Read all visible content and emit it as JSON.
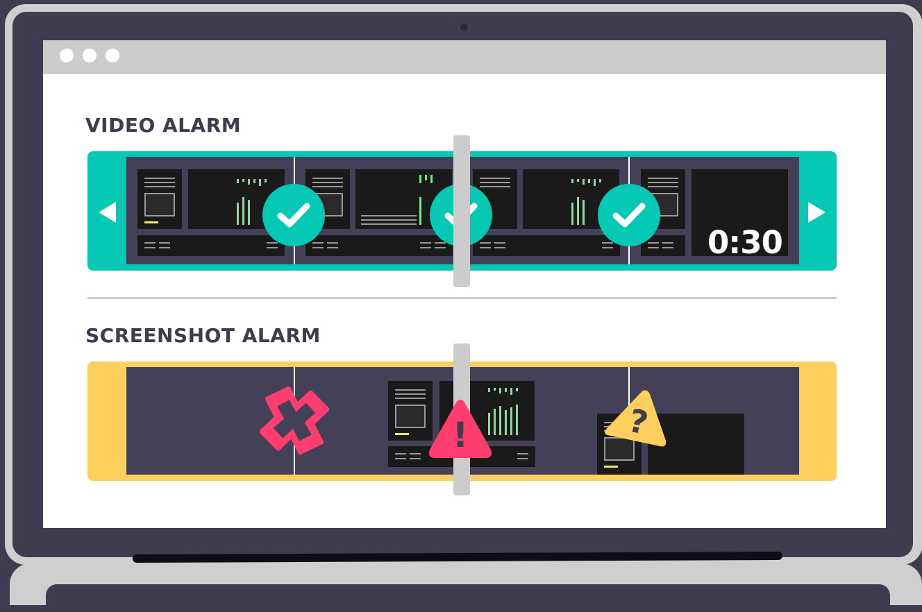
{
  "video_alarm": {
    "title": "VIDEO ALARM",
    "timestamp": "0:30",
    "frame_status": [
      "check-icon",
      "check-icon",
      "check-icon"
    ]
  },
  "screenshot_alarm": {
    "title": "SCREENSHOT ALARM",
    "frame_status": [
      "x-icon",
      "warning-icon",
      "question-icon"
    ],
    "question_glyph": "?",
    "warning_glyph": "!"
  },
  "colors": {
    "video_strip": "#05c8b5",
    "screenshot_strip": "#fecf5c",
    "error": "#ff3d6e",
    "warning": "#ff3d6e",
    "question": "#fecf5c"
  }
}
